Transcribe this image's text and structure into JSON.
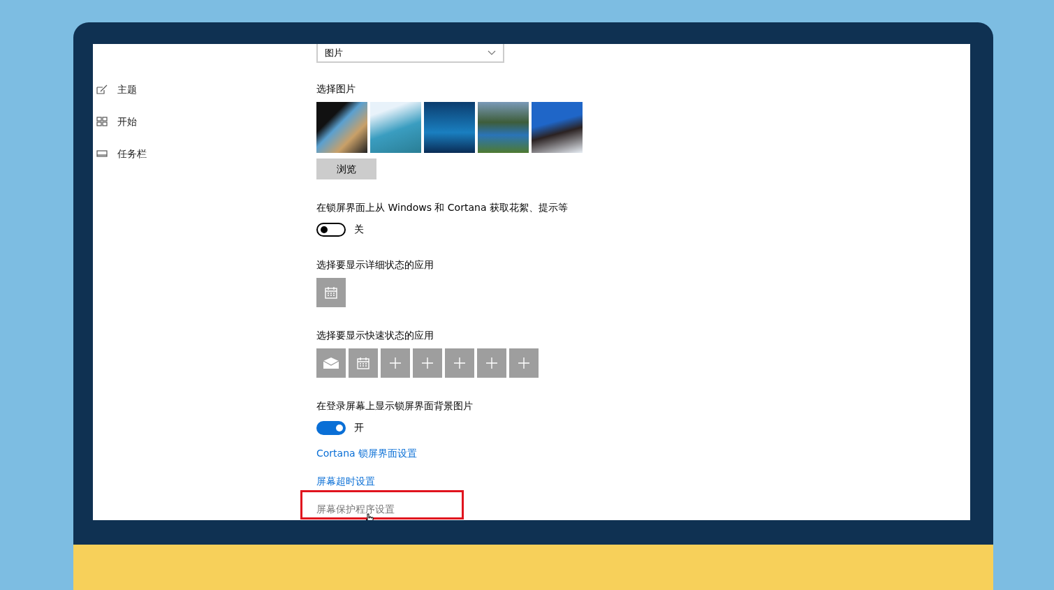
{
  "sidebar": {
    "items": [
      {
        "label": "主题",
        "kind": "brush"
      },
      {
        "label": "开始",
        "kind": "grid"
      },
      {
        "label": "任务栏",
        "kind": "taskbar"
      }
    ]
  },
  "background": {
    "dropdown": {
      "value": "图片"
    },
    "picture_label": "选择图片",
    "browse_button": "浏览"
  },
  "fun_facts": {
    "label": "在锁屏界面上从 Windows 和 Cortana 获取花絮、提示等",
    "on": false,
    "state_text": "关"
  },
  "detailed_status": {
    "label": "选择要显示详细状态的应用",
    "apps": [
      {
        "kind": "calendar"
      }
    ]
  },
  "quick_status": {
    "label": "选择要显示快速状态的应用",
    "apps": [
      {
        "kind": "mail"
      },
      {
        "kind": "calendar"
      },
      {
        "kind": "add"
      },
      {
        "kind": "add"
      },
      {
        "kind": "add"
      },
      {
        "kind": "add"
      },
      {
        "kind": "add"
      }
    ]
  },
  "signin_background": {
    "label": "在登录屏幕上显示锁屏界面背景图片",
    "on": true,
    "state_text": "开"
  },
  "links": [
    {
      "text": "Cortana 锁屏界面设置",
      "highlighted": false
    },
    {
      "text": "屏幕超时设置",
      "highlighted": false
    },
    {
      "text": "屏幕保护程序设置",
      "highlighted": true
    }
  ]
}
